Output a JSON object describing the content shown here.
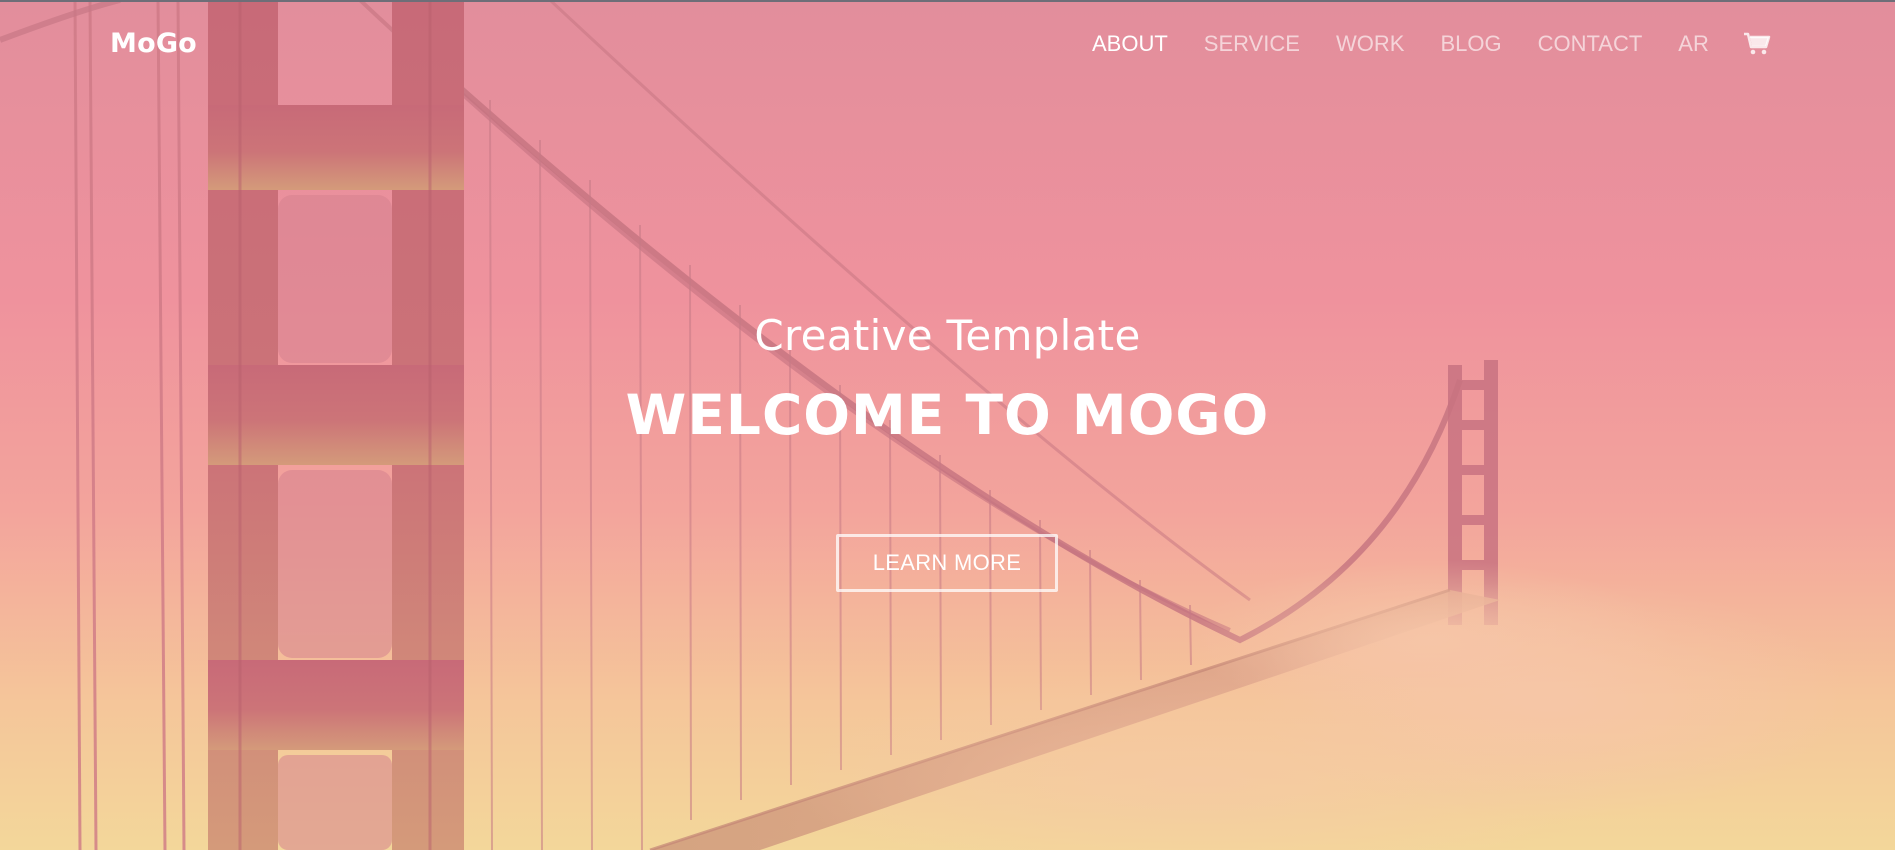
{
  "brand": "MoGo",
  "nav": {
    "items": [
      {
        "label": "ABOUT",
        "active": true
      },
      {
        "label": "SERVICE",
        "active": false
      },
      {
        "label": "WORK",
        "active": false
      },
      {
        "label": "BLOG",
        "active": false
      },
      {
        "label": "CONTACT",
        "active": false
      },
      {
        "label": "AR",
        "active": false
      }
    ],
    "cart_icon": "shopping-cart-icon"
  },
  "hero": {
    "subtitle": "Creative Template",
    "title": "WELCOME TO MOGO",
    "cta_label": "LEARN MORE"
  },
  "colors": {
    "overlay_top": "#e28e9c",
    "overlay_bottom": "#f3d79a",
    "text": "#ffffff"
  }
}
